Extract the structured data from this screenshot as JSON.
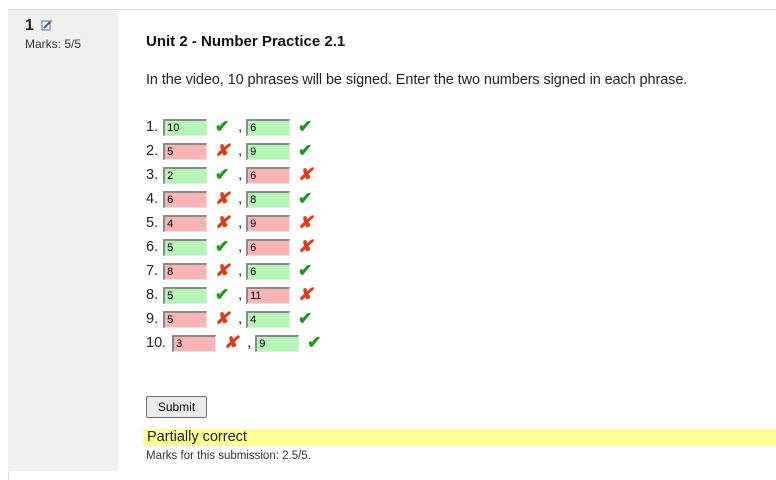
{
  "question": {
    "number": "1",
    "marks": "Marks: 5/5",
    "title": "Unit 2 - Number Practice 2.1",
    "instruction": "In the video, 10 phrases will be signed. Enter the two numbers signed in each phrase.",
    "edit_icon": "edit-icon"
  },
  "rows": [
    {
      "label": "1.",
      "a": {
        "value": "10",
        "correct": true
      },
      "b": {
        "value": "6",
        "correct": true
      }
    },
    {
      "label": "2.",
      "a": {
        "value": "5",
        "correct": false
      },
      "b": {
        "value": "9",
        "correct": true
      }
    },
    {
      "label": "3.",
      "a": {
        "value": "2",
        "correct": true
      },
      "b": {
        "value": "6",
        "correct": false
      }
    },
    {
      "label": "4.",
      "a": {
        "value": "6",
        "correct": false
      },
      "b": {
        "value": "8",
        "correct": true
      }
    },
    {
      "label": "5.",
      "a": {
        "value": "4",
        "correct": false
      },
      "b": {
        "value": "9",
        "correct": false
      }
    },
    {
      "label": "6.",
      "a": {
        "value": "5",
        "correct": true
      },
      "b": {
        "value": "6",
        "correct": false
      }
    },
    {
      "label": "7.",
      "a": {
        "value": "8",
        "correct": false
      },
      "b": {
        "value": "6",
        "correct": true
      }
    },
    {
      "label": "8.",
      "a": {
        "value": "5",
        "correct": true
      },
      "b": {
        "value": "11",
        "correct": false
      }
    },
    {
      "label": "9.",
      "a": {
        "value": "5",
        "correct": false
      },
      "b": {
        "value": "4",
        "correct": true
      }
    },
    {
      "label": "10.",
      "a": {
        "value": "3",
        "correct": false
      },
      "b": {
        "value": "9",
        "correct": true
      }
    }
  ],
  "separator": ",",
  "submit_label": "Submit",
  "feedback": {
    "status": "Partially correct",
    "marks_text": "Marks for this submission: 2.5/5."
  },
  "colors": {
    "correct_bg": "#b5f5b5",
    "wrong_bg": "#f9b5b5",
    "tick": "#1a9a16",
    "cross": "#e03c14",
    "feedback_bg": "#ffff99"
  }
}
